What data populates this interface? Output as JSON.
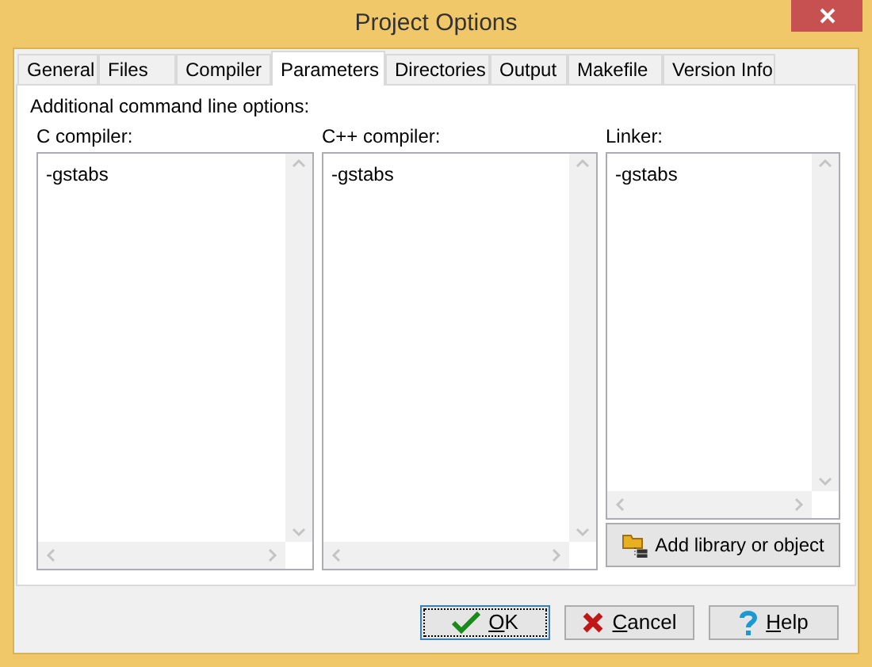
{
  "window": {
    "title": "Project Options"
  },
  "tabs": [
    {
      "label": "General",
      "selected": false
    },
    {
      "label": "Files",
      "selected": false
    },
    {
      "label": "Compiler",
      "selected": false
    },
    {
      "label": "Parameters",
      "selected": true
    },
    {
      "label": "Directories",
      "selected": false
    },
    {
      "label": "Output",
      "selected": false
    },
    {
      "label": "Makefile",
      "selected": false
    },
    {
      "label": "Version Info",
      "selected": false
    }
  ],
  "section_label": "Additional command line options:",
  "fields": [
    {
      "label": "C compiler:",
      "value": "-gstabs"
    },
    {
      "label": "C++ compiler:",
      "value": "-gstabs"
    },
    {
      "label": "Linker:",
      "value": "-gstabs"
    }
  ],
  "add_button": {
    "label": "Add library or object"
  },
  "buttons": [
    {
      "kind": "ok",
      "label": "OK",
      "focused": true
    },
    {
      "kind": "cancel",
      "label": "Cancel",
      "focused": false
    },
    {
      "kind": "help",
      "label": "Help",
      "focused": false
    }
  ]
}
